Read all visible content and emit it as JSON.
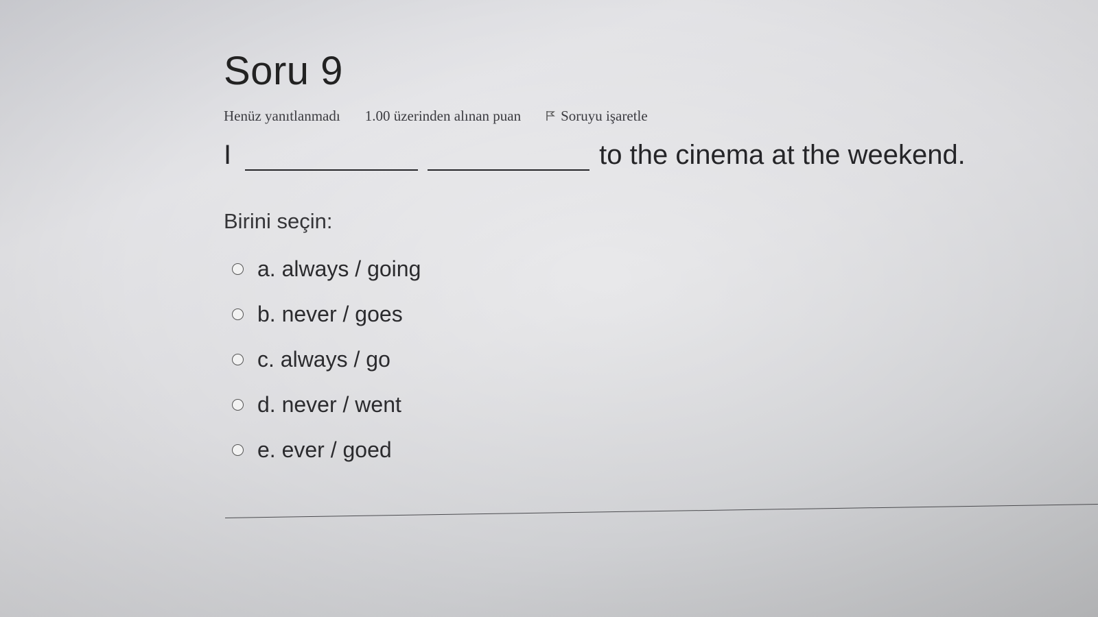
{
  "question": {
    "title": "Soru 9",
    "state": "Henüz yanıtlanmadı",
    "grade": "1.00 üzerinden alınan puan",
    "flag_label": "Soruyu işaretle",
    "text_prefix": "I",
    "text_suffix": "to the cinema at the weekend.",
    "prompt": "Birini seçin:",
    "answers": [
      {
        "label": "a. always / going"
      },
      {
        "label": "b. never / goes"
      },
      {
        "label": "c. always / go"
      },
      {
        "label": "d. never / went"
      },
      {
        "label": "e. ever / goed"
      }
    ]
  },
  "icons": {
    "flag": "flag-icon",
    "radio": "radio-button"
  }
}
